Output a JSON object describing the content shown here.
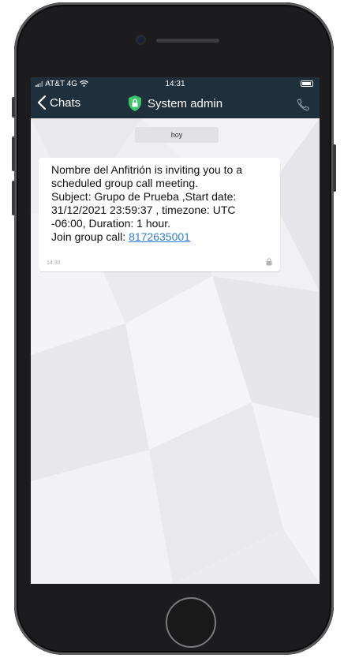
{
  "status_bar": {
    "carrier": "AT&T 4G",
    "time": "14:31"
  },
  "nav": {
    "back_label": "Chats",
    "title": "System admin"
  },
  "chat": {
    "date_chip": "hoy",
    "message": {
      "lines": [
        "Nombre del Anfitrión is inviting you to a",
        "scheduled group call meeting.",
        "Subject: Grupo de Prueba ,Start date:",
        "31/12/2021 23:59:37 , timezone: UTC",
        "-06:00, Duration: 1 hour."
      ],
      "join_prefix": "Join group call: ",
      "join_number": "8172635001",
      "time": "14:30"
    }
  },
  "colors": {
    "header_bg": "#1f2f3c",
    "accent_green": "#3cc76a",
    "link": "#2e7dd7"
  },
  "icons": [
    "chevron-left-icon",
    "shield-lock-icon",
    "phone-call-icon",
    "lock-icon",
    "wifi-icon",
    "signal-icon",
    "battery-icon"
  ]
}
